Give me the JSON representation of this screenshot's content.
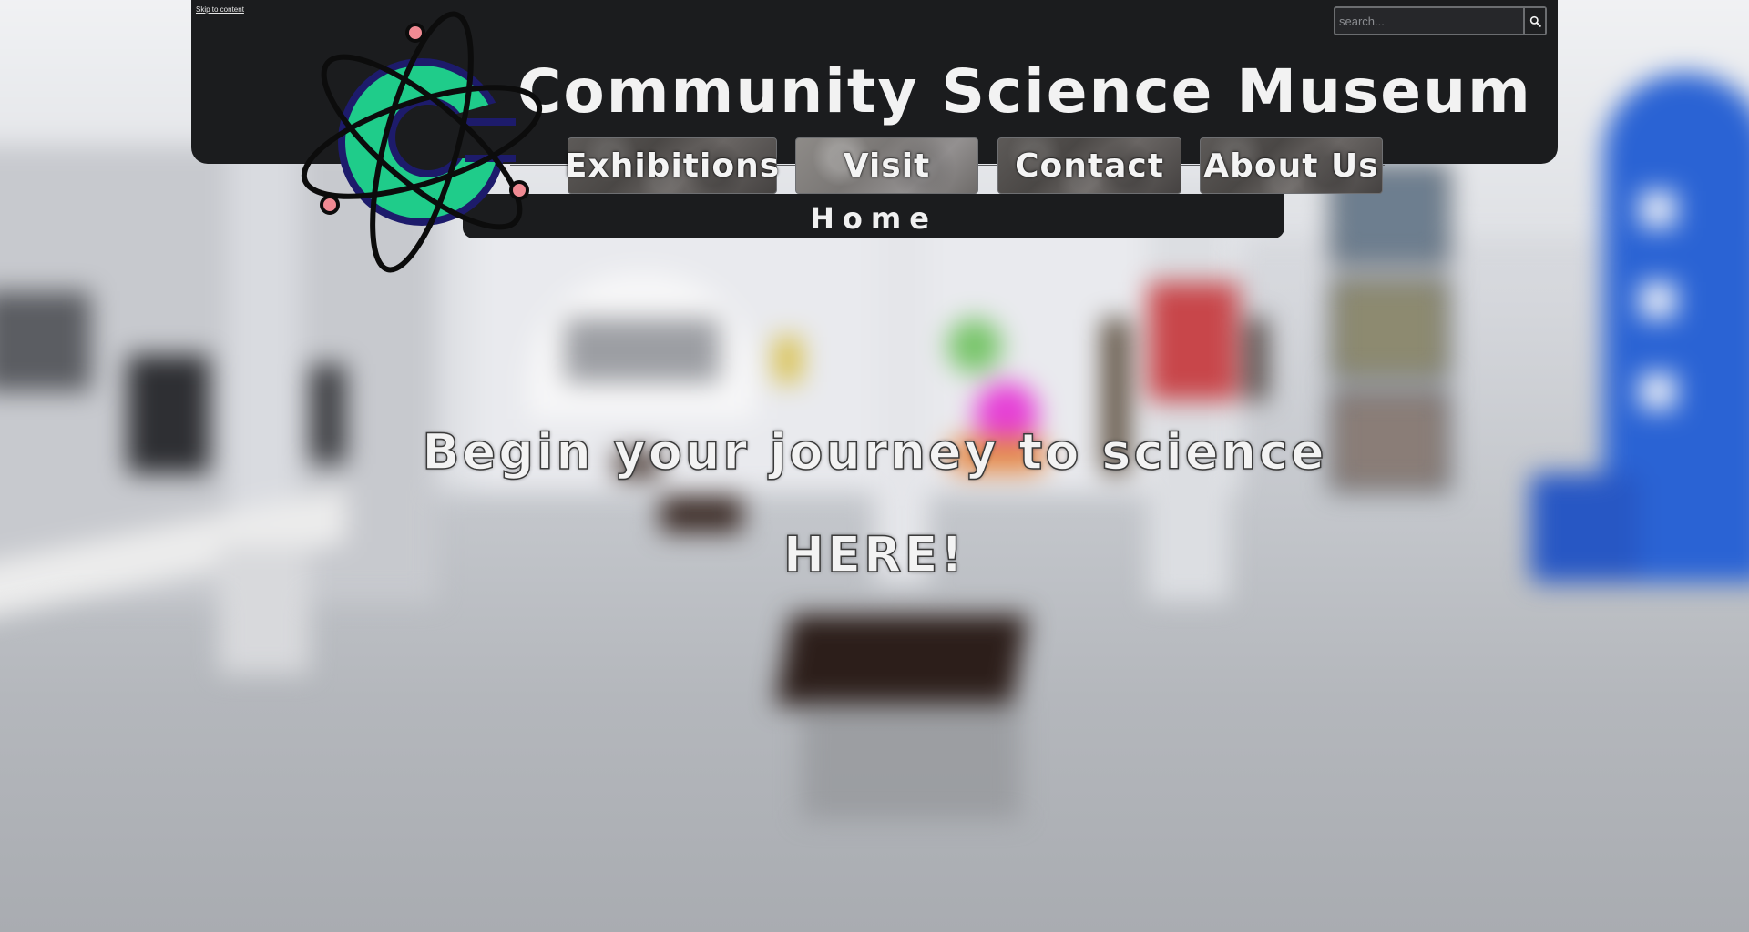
{
  "skip_link": "Skip to content",
  "search": {
    "placeholder": "search..."
  },
  "site_title": "Community Science Museum",
  "nav": {
    "items": [
      {
        "label": "Exhibitions"
      },
      {
        "label": "Visit"
      },
      {
        "label": "Contact"
      },
      {
        "label": "About Us"
      }
    ],
    "current_page": "Home"
  },
  "hero": {
    "line1": "Begin your journey to science",
    "line2": "HERE!"
  },
  "colors": {
    "header_bg": "#1b1c1e",
    "logo_green": "#1fcc8a",
    "logo_navy": "#1d1b6b",
    "logo_dot": "#f08a93"
  },
  "icons": {
    "search_button": "search-icon",
    "logo": "atom-c-logo-icon"
  }
}
